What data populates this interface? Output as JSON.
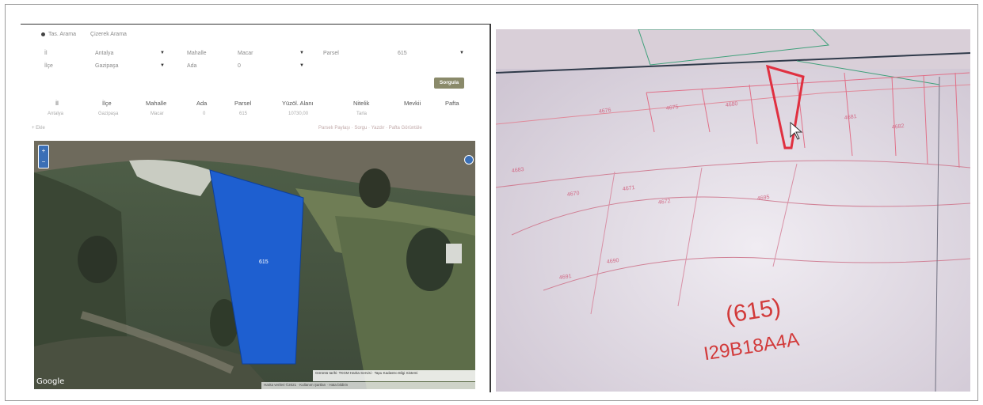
{
  "search_mode": {
    "options": [
      "Tas. Arama",
      "Çizerek Arama"
    ]
  },
  "form": {
    "il_label": "İl",
    "il_value": "Antalya",
    "ilce_label": "İlçe",
    "ilce_value": "Gazipaşa",
    "mahalle_label": "Mahalle",
    "mahalle_value": "Macar",
    "ada_label": "Ada",
    "ada_value": "0",
    "parsel_label": "Parsel",
    "parsel_value": "615",
    "query_button": "Sorgula"
  },
  "results_table": {
    "headers": [
      "İl",
      "İlçe",
      "Mahalle",
      "Ada",
      "Parsel",
      "Yüzöl. Alanı",
      "Nitelik",
      "Mevkii",
      "Pafta"
    ],
    "row": [
      "Antalya",
      "Gazipaşa",
      "Macar",
      "0",
      "615",
      "10730,00",
      "Tarla",
      "",
      ""
    ]
  },
  "meta": {
    "left": "+ Ekle",
    "right": "Parselı Paylaşı · Sorgu · Yazdır · Pafta Görüntüle"
  },
  "map": {
    "zoom_in": "+",
    "zoom_out": "−",
    "parcel_label": "615",
    "google_logo": "Google",
    "attribution_top": "Görüntü tarihi: TKGM Harita Servisi · Tapu Kadastro Bilgi Sistemi",
    "attribution_bottom": "Harita verileri ©2021 · Kullanım Şartları · Hata bildirin"
  },
  "cadastral": {
    "parcel_number": "(615)",
    "sheet_code": "I29B18A4A",
    "labels": [
      "4676",
      "4675",
      "4680",
      "4681",
      "4682",
      "4683",
      "4670",
      "4671",
      "4672",
      "4695",
      "4690",
      "4691"
    ]
  },
  "colors": {
    "parcel_fill": "#1e5fd0",
    "cadastral_red": "#d23a3a",
    "query_button": "#8a8a6a"
  }
}
